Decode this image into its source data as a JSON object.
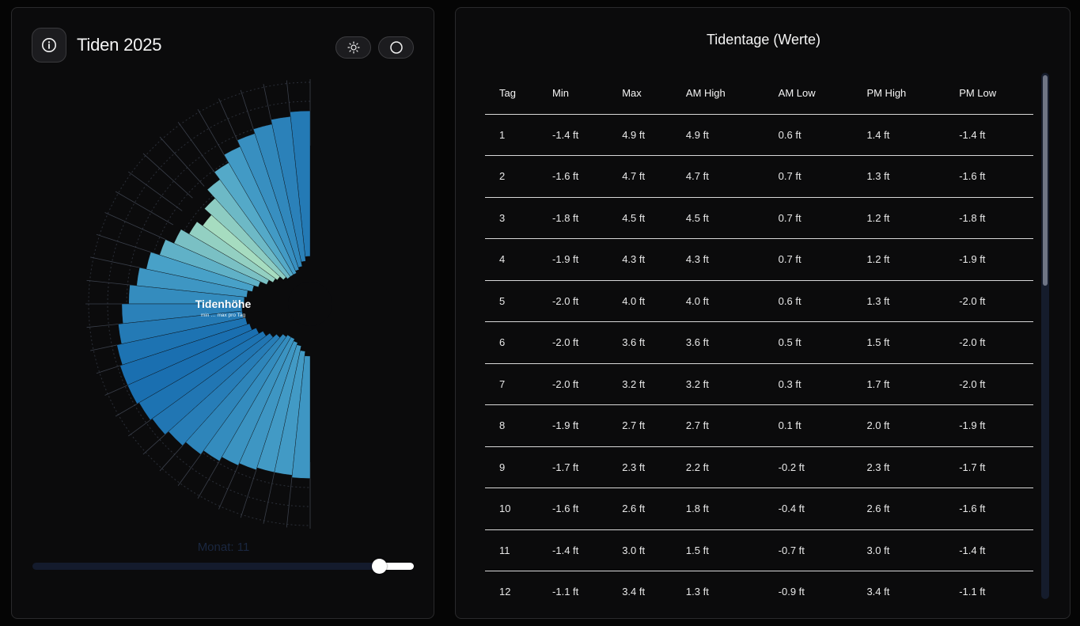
{
  "app": {
    "title": "Tiden 2025"
  },
  "header": {
    "info_icon": "info-circle-icon",
    "theme_icon": "sun-icon",
    "mode_icon": "circle-icon"
  },
  "chart": {
    "center_title": "Tidenhöhe",
    "center_subtitle": "min … max pro Tag",
    "month_label": "Monat: 11"
  },
  "slider": {
    "min": 1,
    "max": 12,
    "value": 11
  },
  "table": {
    "title": "Tidentage (Werte)",
    "columns": [
      "Tag",
      "Min",
      "Max",
      "AM High",
      "AM Low",
      "PM High",
      "PM Low"
    ],
    "rows": [
      [
        "1",
        "-1.4 ft",
        "4.9 ft",
        "4.9 ft",
        "0.6 ft",
        "1.4 ft",
        "-1.4 ft"
      ],
      [
        "2",
        "-1.6 ft",
        "4.7 ft",
        "4.7 ft",
        "0.7 ft",
        "1.3 ft",
        "-1.6 ft"
      ],
      [
        "3",
        "-1.8 ft",
        "4.5 ft",
        "4.5 ft",
        "0.7 ft",
        "1.2 ft",
        "-1.8 ft"
      ],
      [
        "4",
        "-1.9 ft",
        "4.3 ft",
        "4.3 ft",
        "0.7 ft",
        "1.2 ft",
        "-1.9 ft"
      ],
      [
        "5",
        "-2.0 ft",
        "4.0 ft",
        "4.0 ft",
        "0.6 ft",
        "1.3 ft",
        "-2.0 ft"
      ],
      [
        "6",
        "-2.0 ft",
        "3.6 ft",
        "3.6 ft",
        "0.5 ft",
        "1.5 ft",
        "-2.0 ft"
      ],
      [
        "7",
        "-2.0 ft",
        "3.2 ft",
        "3.2 ft",
        "0.3 ft",
        "1.7 ft",
        "-2.0 ft"
      ],
      [
        "8",
        "-1.9 ft",
        "2.7 ft",
        "2.7 ft",
        "0.1 ft",
        "2.0 ft",
        "-1.9 ft"
      ],
      [
        "9",
        "-1.7 ft",
        "2.3 ft",
        "2.2 ft",
        "-0.2 ft",
        "2.3 ft",
        "-1.7 ft"
      ],
      [
        "10",
        "-1.6 ft",
        "2.6 ft",
        "1.8 ft",
        "-0.4 ft",
        "2.6 ft",
        "-1.6 ft"
      ],
      [
        "11",
        "-1.4 ft",
        "3.0 ft",
        "1.5 ft",
        "-0.7 ft",
        "3.0 ft",
        "-1.4 ft"
      ],
      [
        "12",
        "-1.1 ft",
        "3.4 ft",
        "1.3 ft",
        "-0.9 ft",
        "3.4 ft",
        "-1.1 ft"
      ]
    ]
  },
  "chart_data": {
    "type": "bar",
    "days_in_month": 30,
    "min_values": [
      -1.4,
      -1.6,
      -1.8,
      -1.9,
      -2.0,
      -2.0,
      -2.0,
      -1.9,
      -1.7,
      -1.6,
      -1.4,
      -1.1,
      -0.9,
      -0.7,
      -0.6,
      -0.5,
      -0.5,
      -0.6,
      -0.7,
      -0.9,
      -1.1,
      -1.3,
      -1.5,
      -1.7,
      -1.8,
      -1.8,
      -1.7,
      -1.6,
      -1.4,
      -1.2
    ],
    "max_values": [
      4.9,
      4.7,
      4.5,
      4.3,
      4.0,
      3.6,
      3.2,
      2.7,
      2.3,
      2.6,
      3.0,
      3.4,
      3.8,
      4.1,
      4.4,
      4.7,
      4.9,
      5.1,
      5.2,
      5.2,
      5.1,
      5.0,
      4.8,
      4.6,
      4.4,
      4.2,
      4.1,
      4.0,
      4.0,
      4.1
    ],
    "colors": {
      "low": "#a6dcc0",
      "mid": "#4aa3c9",
      "high": "#1a6fb0"
    }
  }
}
